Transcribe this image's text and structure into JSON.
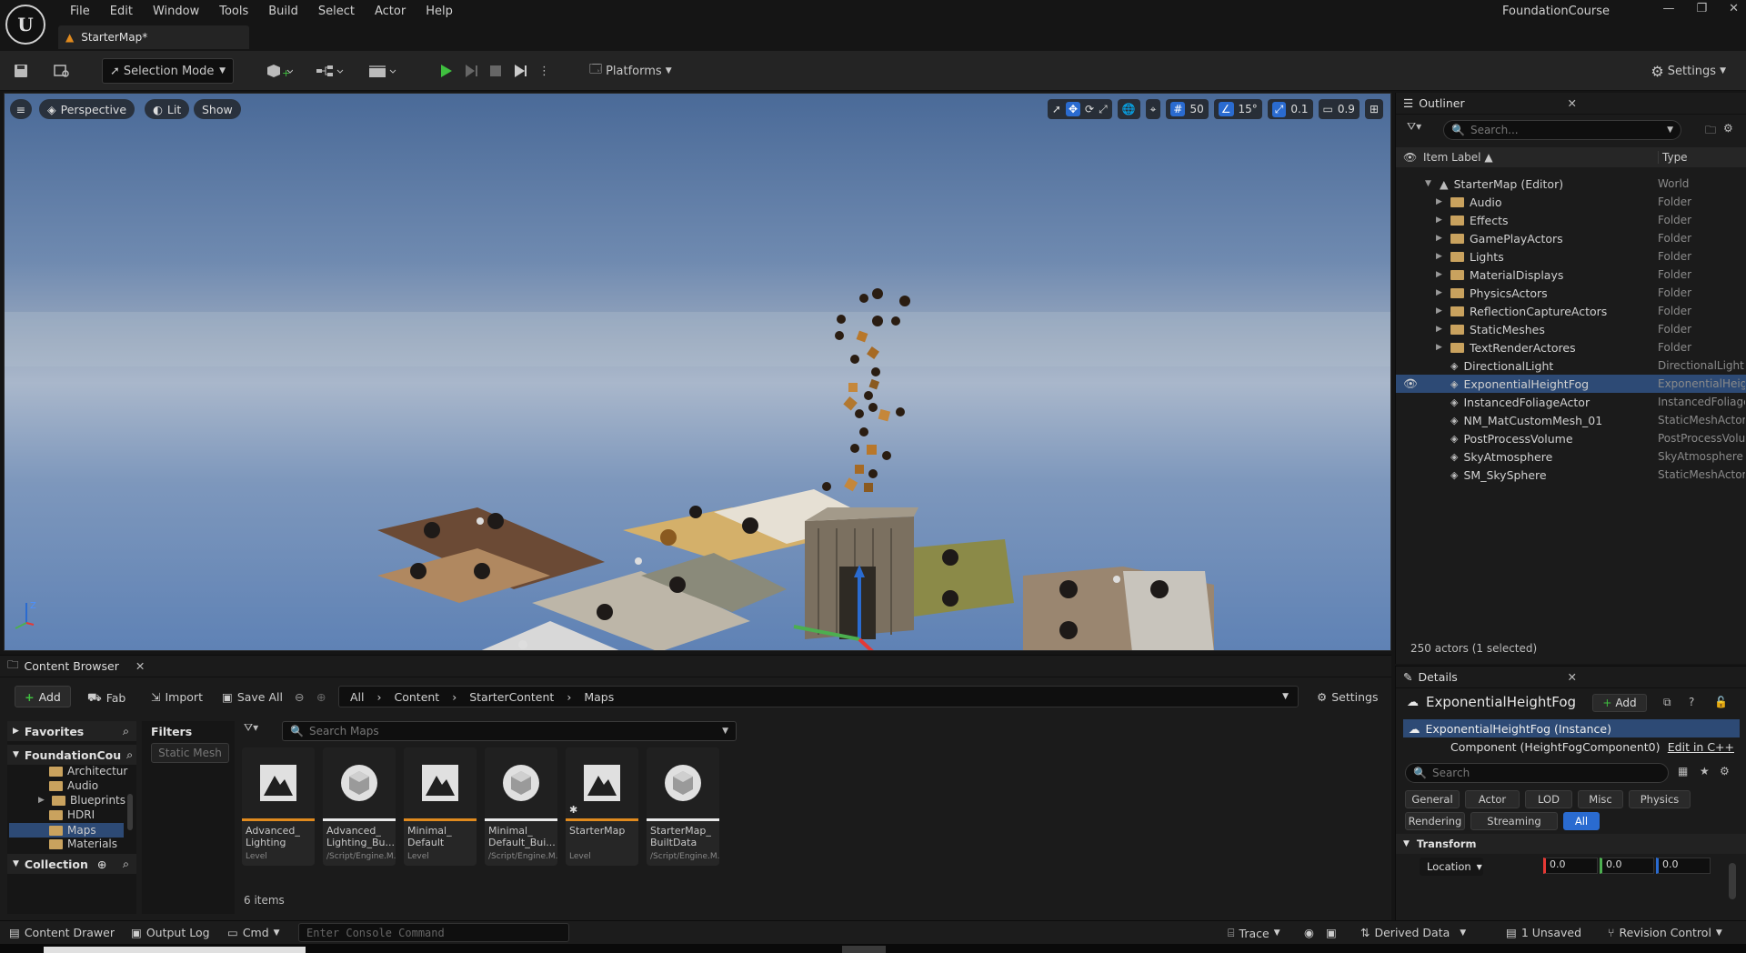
{
  "menu": [
    "File",
    "Edit",
    "Window",
    "Tools",
    "Build",
    "Select",
    "Actor",
    "Help"
  ],
  "project_name": "FoundationCourse",
  "window_controls": [
    "—",
    "❐",
    "✕"
  ],
  "document_tab": "StarterMap*",
  "toolbar": {
    "selection_mode": "Selection Mode",
    "platforms": "Platforms",
    "settings": "Settings"
  },
  "viewport": {
    "perspective": "Perspective",
    "lit": "Lit",
    "show": "Show",
    "grid_snap": "50",
    "rotation_snap": "15°",
    "scale_snap": "0.1",
    "camera_speed": "0.9"
  },
  "outliner": {
    "title": "Outliner",
    "search_placeholder": "Search...",
    "col_label": "Item Label",
    "col_type": "Type",
    "root": {
      "label": "StarterMap (Editor)",
      "type": "World"
    },
    "items": [
      {
        "label": "Audio",
        "type": "Folder",
        "kind": "folder"
      },
      {
        "label": "Effects",
        "type": "Folder",
        "kind": "folder"
      },
      {
        "label": "GamePlayActors",
        "type": "Folder",
        "kind": "folder"
      },
      {
        "label": "Lights",
        "type": "Folder",
        "kind": "folder"
      },
      {
        "label": "MaterialDisplays",
        "type": "Folder",
        "kind": "folder"
      },
      {
        "label": "PhysicsActors",
        "type": "Folder",
        "kind": "folder"
      },
      {
        "label": "ReflectionCaptureActors",
        "type": "Folder",
        "kind": "folder"
      },
      {
        "label": "StaticMeshes",
        "type": "Folder",
        "kind": "folder"
      },
      {
        "label": "TextRenderActores",
        "type": "Folder",
        "kind": "folder"
      },
      {
        "label": "DirectionalLight",
        "type": "DirectionalLight",
        "kind": "actor"
      },
      {
        "label": "ExponentialHeightFog",
        "type": "ExponentialHeightFog",
        "kind": "actor",
        "selected": true
      },
      {
        "label": "InstancedFoliageActor",
        "type": "InstancedFoliageActor",
        "kind": "actor"
      },
      {
        "label": "NM_MatCustomMesh_01",
        "type": "StaticMeshActor",
        "kind": "actor"
      },
      {
        "label": "PostProcessVolume",
        "type": "PostProcessVolume",
        "kind": "actor"
      },
      {
        "label": "SkyAtmosphere",
        "type": "SkyAtmosphere",
        "kind": "actor"
      },
      {
        "label": "SM_SkySphere",
        "type": "StaticMeshActor",
        "kind": "actor"
      }
    ],
    "status": "250 actors (1 selected)"
  },
  "details": {
    "title": "Details",
    "actor_name": "ExponentialHeightFog",
    "add": "Add",
    "instance": "ExponentialHeightFog (Instance)",
    "component": "Component (HeightFogComponent0)",
    "edit_cpp": "Edit in C++",
    "search_placeholder": "Search",
    "filters_row1": [
      "General",
      "Actor",
      "LOD",
      "Misc",
      "Physics"
    ],
    "filters_row2": [
      "Rendering",
      "Streaming",
      "All"
    ],
    "section": "Transform",
    "location_label": "Location",
    "location": [
      "0.0",
      "0.0",
      "0.0"
    ]
  },
  "content_browser": {
    "title": "Content Browser",
    "add": "Add",
    "fab": "Fab",
    "import": "Import",
    "save_all": "Save All",
    "path": [
      "All",
      "Content",
      "StarterContent",
      "Maps"
    ],
    "settings": "Settings",
    "favorites": "Favorites",
    "project_root": "FoundationCou",
    "tree": [
      "Architectur",
      "Audio",
      "Blueprints",
      "HDRI",
      "Maps",
      "Materials"
    ],
    "collection": "Collection",
    "filters_title": "Filters",
    "filter_chip": "Static Mesh",
    "search_placeholder": "Search Maps",
    "assets": [
      {
        "name": "Advanced_ Lighting",
        "kind": "Level",
        "type": "level"
      },
      {
        "name": "Advanced_ Lighting_Bu...",
        "kind": "/Script/Engine.M...",
        "type": "data"
      },
      {
        "name": "Minimal_ Default",
        "kind": "Level",
        "type": "level"
      },
      {
        "name": "Minimal_ Default_Bui...",
        "kind": "/Script/Engine.M...",
        "type": "data"
      },
      {
        "name": "StarterMap",
        "kind": "Level",
        "type": "level"
      },
      {
        "name": "StarterMap_ BuiltData",
        "kind": "/Script/Engine.M...",
        "type": "data"
      }
    ],
    "item_count": "6 items"
  },
  "statusbar": {
    "content_drawer": "Content Drawer",
    "output_log": "Output Log",
    "cmd": "Cmd",
    "console_placeholder": "Enter Console Command",
    "trace": "Trace",
    "derived_data": "Derived Data",
    "unsaved": "1 Unsaved",
    "revision_control": "Revision Control"
  },
  "colors": {
    "accent": "#2a6bd0",
    "level_bar": "#e08a1e",
    "data_bar": "#e8e8e8",
    "selected_row": "#2d4a75",
    "play": "#3fbf3f",
    "folder": "#c9a25e"
  }
}
